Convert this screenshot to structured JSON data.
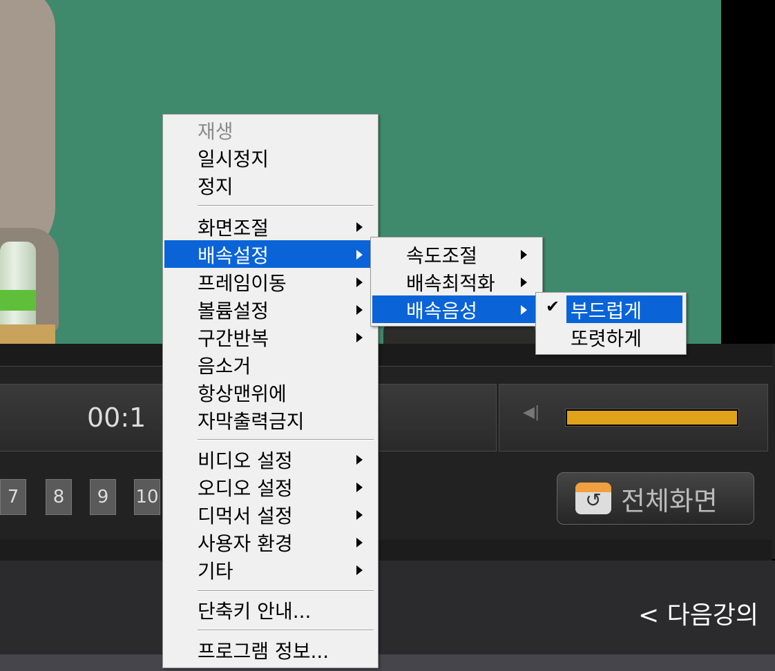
{
  "player": {
    "time": "00:1",
    "volume_level": 1.0,
    "chapters": [
      "7",
      "8",
      "9",
      "10"
    ],
    "fullscreen_label": "전체화면",
    "next_lecture_label": "< 다음강의",
    "colors": {
      "volume_fill": "#e0a11b",
      "video_bg": "#3f8a6c",
      "highlight": "#0a64d8"
    }
  },
  "context_menu": {
    "items": [
      {
        "label": "재생",
        "disabled": true
      },
      {
        "label": "일시정지"
      },
      {
        "label": "정지"
      },
      {
        "label": "화면조절",
        "submenu": true
      },
      {
        "label": "배속설정",
        "submenu": true,
        "highlighted": true
      },
      {
        "label": "프레임이동",
        "submenu": true
      },
      {
        "label": "볼륨설정",
        "submenu": true
      },
      {
        "label": "구간반복",
        "submenu": true
      },
      {
        "label": "음소거"
      },
      {
        "label": "항상맨위에"
      },
      {
        "label": "자막출력금지"
      },
      {
        "label": "비디오 설정",
        "submenu": true
      },
      {
        "label": "오디오 설정",
        "submenu": true
      },
      {
        "label": "디먹서 설정",
        "submenu": true
      },
      {
        "label": "사용자 환경",
        "submenu": true
      },
      {
        "label": "기타",
        "submenu": true
      },
      {
        "label": "단축키 안내..."
      },
      {
        "label": "프로그램 정보..."
      }
    ]
  },
  "speed_submenu": {
    "items": [
      {
        "label": "속도조절",
        "submenu": true
      },
      {
        "label": "배속최적화",
        "submenu": true
      },
      {
        "label": "배속음성",
        "submenu": true,
        "highlighted": true
      }
    ]
  },
  "voice_submenu": {
    "items": [
      {
        "label": "부드럽게",
        "checked": true,
        "highlighted": true
      },
      {
        "label": "또렷하게",
        "checked": false
      }
    ]
  },
  "icons": {
    "volume": "speaker-icon",
    "fullscreen": "fullscreen-icon",
    "check": "checkmark-icon",
    "submenu": "submenu-arrow-icon"
  }
}
